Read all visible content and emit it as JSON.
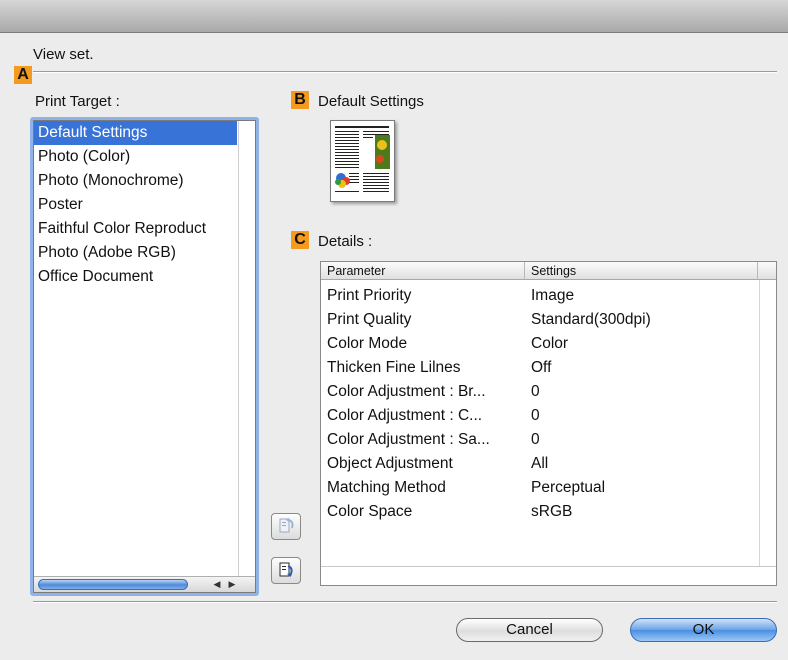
{
  "dialog": {
    "section_title": "View set.",
    "marker_a": "A",
    "marker_b": "B",
    "marker_c": "C"
  },
  "print_target": {
    "label": "Print Target :",
    "items": [
      {
        "label": "Default Settings",
        "selected": true
      },
      {
        "label": "Photo (Color)",
        "selected": false
      },
      {
        "label": "Photo (Monochrome)",
        "selected": false
      },
      {
        "label": "Poster",
        "selected": false
      },
      {
        "label": "Faithful Color Reproduct",
        "selected": false
      },
      {
        "label": "Photo (Adobe RGB)",
        "selected": false
      },
      {
        "label": "Office Document",
        "selected": false
      }
    ]
  },
  "preview": {
    "title": "Default Settings"
  },
  "details": {
    "label": "Details :",
    "columns": [
      "Parameter",
      "Settings"
    ],
    "rows": [
      {
        "parameter": "Print Priority",
        "setting": "Image"
      },
      {
        "parameter": "Print Quality",
        "setting": "Standard(300dpi)"
      },
      {
        "parameter": "Color Mode",
        "setting": "Color"
      },
      {
        "parameter": "Thicken Fine Lilnes",
        "setting": "Off"
      },
      {
        "parameter": "Color Adjustment : Br...",
        "setting": "0"
      },
      {
        "parameter": "Color Adjustment : C...",
        "setting": "0"
      },
      {
        "parameter": "Color Adjustment : Sa...",
        "setting": "0"
      },
      {
        "parameter": "Object Adjustment",
        "setting": "All"
      },
      {
        "parameter": "Matching Method",
        "setting": "Perceptual"
      },
      {
        "parameter": "Color Space",
        "setting": "sRGB"
      }
    ]
  },
  "buttons": {
    "cancel": "Cancel",
    "ok": "OK"
  },
  "icons": {
    "restore": "restore-settings-icon",
    "apply": "apply-settings-icon"
  },
  "colors": {
    "selection": "#3874d7",
    "marker": "#f39a1f",
    "focus_ring": "#8fb3e6"
  }
}
